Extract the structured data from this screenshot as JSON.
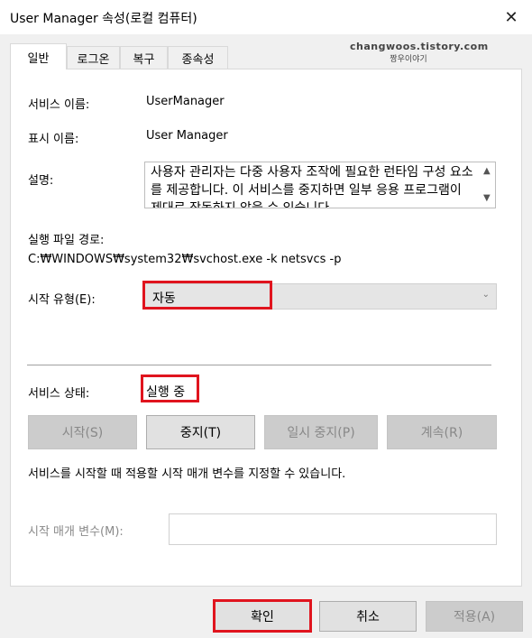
{
  "window": {
    "title": "User Manager 속성(로컬 컴퓨터)",
    "close_glyph": "✕"
  },
  "watermark": {
    "line1": "changwoos.tistory.com",
    "line2": "짱우이야기"
  },
  "tabs": [
    {
      "label": "일반",
      "active": true
    },
    {
      "label": "로그온",
      "active": false
    },
    {
      "label": "복구",
      "active": false
    },
    {
      "label": "종속성",
      "active": false
    }
  ],
  "general": {
    "service_name_label": "서비스 이름:",
    "service_name_value": "UserManager",
    "display_name_label": "표시 이름:",
    "display_name_value": "User Manager",
    "description_label": "설명:",
    "description_text": "사용자 관리자는 다중 사용자 조작에 필요한 런타임 구성 요소를 제공합니다. 이 서비스를 중지하면 일부 응용 프로그램이 제대로 작동하지 않을 수 있습니다.",
    "exec_path_label": "실행 파일 경로:",
    "exec_path_value": "C:₩WINDOWS₩system32₩svchost.exe -k netsvcs -p",
    "startup_type_label": "시작 유형(E):",
    "startup_type_value": "자동",
    "status_label": "서비스 상태:",
    "status_value": "실행 중",
    "buttons": {
      "start": "시작(S)",
      "stop": "중지(T)",
      "pause": "일시 중지(P)",
      "resume": "계속(R)"
    },
    "params_hint": "서비스를 시작할 때 적용할 시작 매개 변수를 지정할 수 있습니다.",
    "params_label": "시작 매개 변수(M):",
    "params_value": ""
  },
  "footer": {
    "ok": "확인",
    "cancel": "취소",
    "apply": "적용(A)"
  },
  "icons": {
    "scroll_up": "▲",
    "scroll_down": "▼",
    "combo_arrow": "⌄"
  },
  "colors": {
    "highlight": "#e0141e",
    "panel": "#ffffff",
    "window": "#f0f0f0"
  }
}
